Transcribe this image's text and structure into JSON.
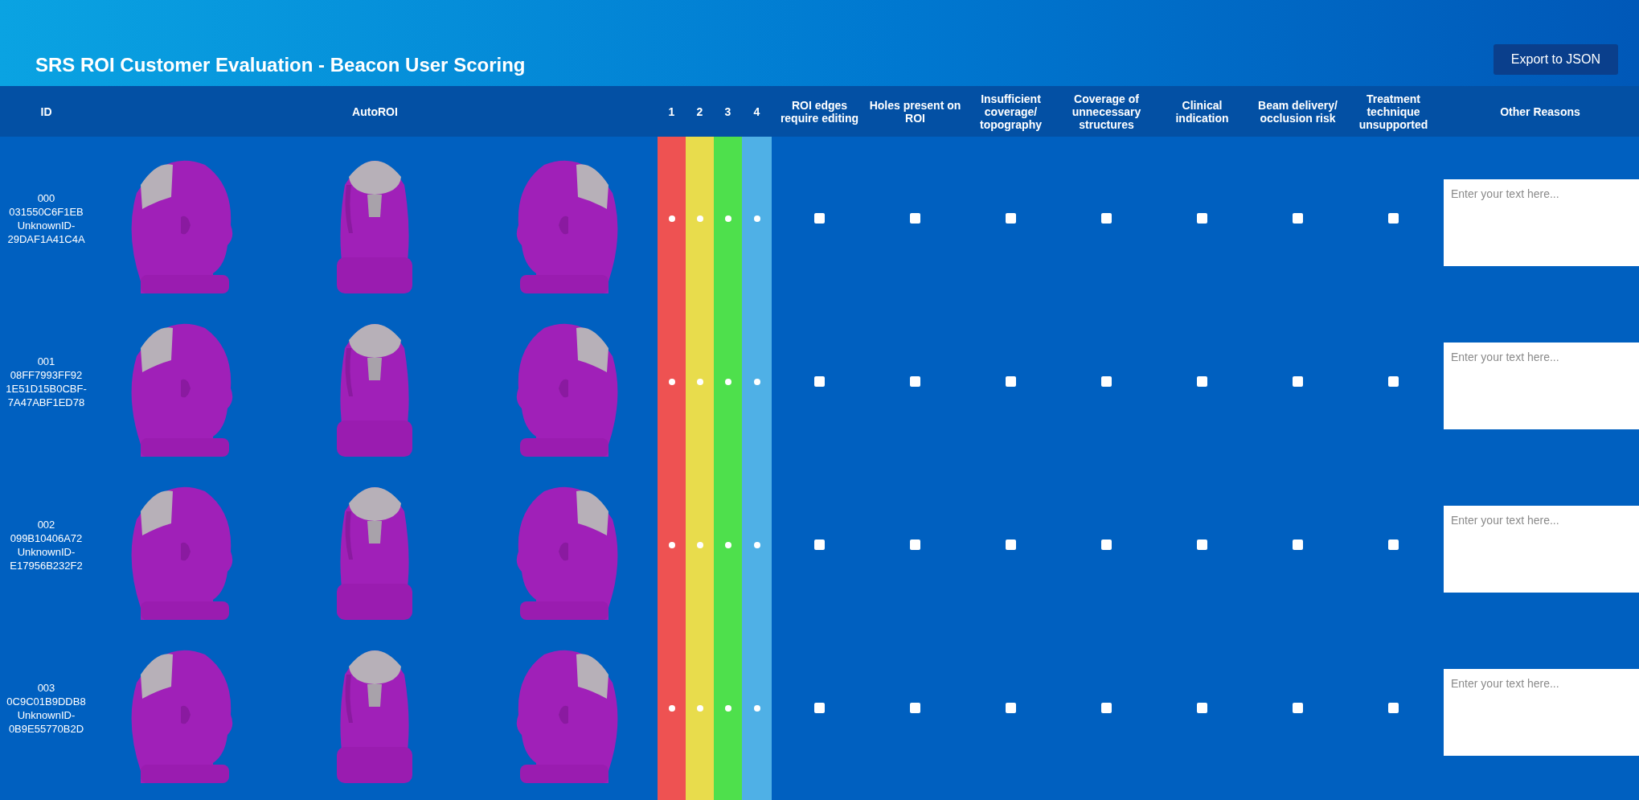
{
  "header": {
    "title": "SRS ROI Customer Evaluation - Beacon User Scoring",
    "export_button": "Export to JSON"
  },
  "columns": {
    "id": "ID",
    "autoroi": "AutoROI",
    "scores": [
      {
        "label": "1",
        "color": "#ee5252"
      },
      {
        "label": "2",
        "color": "#e8dc4c"
      },
      {
        "label": "3",
        "color": "#4ee04c"
      },
      {
        "label": "4",
        "color": "#4fb0e6"
      }
    ],
    "reasons": [
      "ROI edges require editing",
      "Holes present on ROI",
      "Insufficient coverage/ topography",
      "Coverage of unnecessary structures",
      "Clinical indication",
      "Beam delivery/ occlusion risk",
      "Treatment technique unsupported"
    ],
    "other": "Other Reasons"
  },
  "rows": [
    {
      "id_lines": [
        "000",
        "031550C6F1EB",
        "UnknownID-",
        "29DAF1A41C4A"
      ],
      "scores": [
        {
          "selected": false
        },
        {
          "selected": false
        },
        {
          "selected": false
        },
        {
          "selected": false
        }
      ],
      "reasons": [
        {
          "checked": false
        },
        {
          "checked": false
        },
        {
          "checked": false
        },
        {
          "checked": false
        },
        {
          "checked": false
        },
        {
          "checked": false
        },
        {
          "checked": false
        }
      ],
      "other_reasons": {
        "placeholder": "Enter your text here..."
      }
    },
    {
      "id_lines": [
        "001",
        "08FF7993FF92",
        "1E51D15B0CBF-",
        "7A47ABF1ED78"
      ],
      "scores": [
        {
          "selected": false
        },
        {
          "selected": false
        },
        {
          "selected": false
        },
        {
          "selected": false
        }
      ],
      "reasons": [
        {
          "checked": false
        },
        {
          "checked": false
        },
        {
          "checked": false
        },
        {
          "checked": false
        },
        {
          "checked": false
        },
        {
          "checked": false
        },
        {
          "checked": false
        }
      ],
      "other_reasons": {
        "placeholder": "Enter your text here..."
      }
    },
    {
      "id_lines": [
        "002",
        "099B10406A72",
        "UnknownID-",
        "E17956B232F2"
      ],
      "scores": [
        {
          "selected": false
        },
        {
          "selected": false
        },
        {
          "selected": false
        },
        {
          "selected": false
        }
      ],
      "reasons": [
        {
          "checked": false
        },
        {
          "checked": false
        },
        {
          "checked": false
        },
        {
          "checked": false
        },
        {
          "checked": false
        },
        {
          "checked": false
        },
        {
          "checked": false
        }
      ],
      "other_reasons": {
        "placeholder": "Enter your text here..."
      }
    },
    {
      "id_lines": [
        "003",
        "0C9C01B9DDB8",
        "UnknownID-",
        "0B9E55770B2D"
      ],
      "scores": [
        {
          "selected": false
        },
        {
          "selected": false
        },
        {
          "selected": false
        },
        {
          "selected": false
        }
      ],
      "reasons": [
        {
          "checked": false
        },
        {
          "checked": false
        },
        {
          "checked": false
        },
        {
          "checked": false
        },
        {
          "checked": false
        },
        {
          "checked": false
        },
        {
          "checked": false
        }
      ],
      "other_reasons": {
        "placeholder": "Enter your text here..."
      }
    }
  ]
}
